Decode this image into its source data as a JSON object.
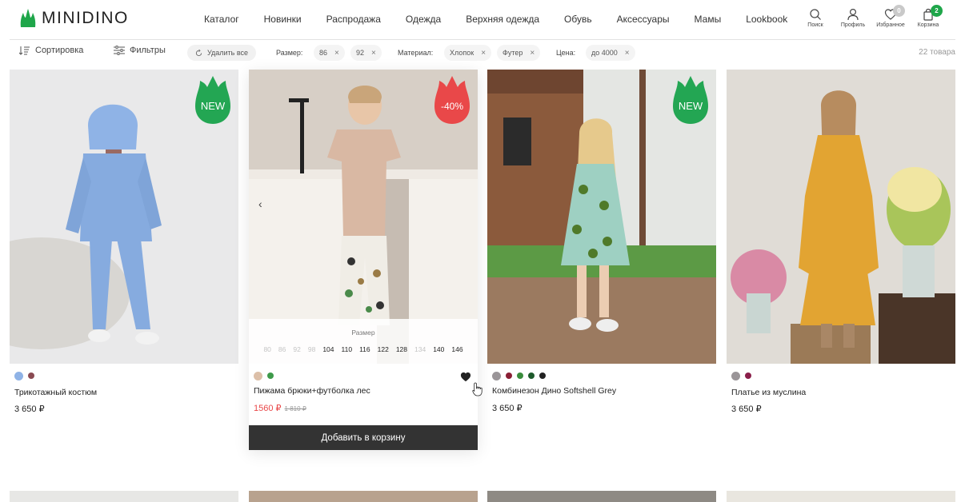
{
  "brand": {
    "name": "MINIDINO"
  },
  "nav": [
    "Каталог",
    "Новинки",
    "Распродажа",
    "Одежда",
    "Верхняя одежда",
    "Обувь",
    "Аксессуары",
    "Мамы",
    "Lookbook"
  ],
  "actions": {
    "search": "Поиск",
    "profile": "Профиль",
    "favorites": "Избранное",
    "favorites_count": "0",
    "cart": "Корзина",
    "cart_count": "2"
  },
  "filters": {
    "sort": "Сортировка",
    "filter": "Фильтры",
    "clear_all": "Удалить все",
    "size_label": "Размер:",
    "size_chips": [
      "86",
      "92"
    ],
    "material_label": "Материал:",
    "material_chips": [
      "Хлопок",
      "Футер"
    ],
    "price_label": "Цена:",
    "price_chip": "до 4000",
    "result_count": "22 товара"
  },
  "products": [
    {
      "name": "Трикотажный костюм",
      "price": "3 650 ₽",
      "badge": "NEW",
      "colors": [
        "#8fb3e6",
        "#8a4a52"
      ]
    },
    {
      "name": "Пижама брюки+футболка лес",
      "price": "1560 ₽",
      "old_price": "1 810 ₽",
      "badge": "-40%",
      "colors": [
        "#dcbfa8",
        "#3e9a4a"
      ],
      "size_title": "Размер",
      "sizes": [
        {
          "label": "80",
          "available": false
        },
        {
          "label": "86",
          "available": false
        },
        {
          "label": "92",
          "available": false
        },
        {
          "label": "98",
          "available": false
        },
        {
          "label": "104",
          "available": true
        },
        {
          "label": "110",
          "available": true
        },
        {
          "label": "116",
          "available": true
        },
        {
          "label": "122",
          "available": true
        },
        {
          "label": "128",
          "available": true
        },
        {
          "label": "134",
          "available": false
        },
        {
          "label": "140",
          "available": true
        },
        {
          "label": "146",
          "available": true
        }
      ],
      "add_to_cart": "Добавить в корзину"
    },
    {
      "name": "Комбинезон Дино Softshell Grey",
      "price": "3 650 ₽",
      "badge": "NEW",
      "colors": [
        "#9a9598",
        "#8a1f35",
        "#3a8c3c",
        "#1d5a2b",
        "#222222"
      ]
    },
    {
      "name": "Платье из муслина",
      "price": "3 650 ₽",
      "colors": [
        "#9a9598",
        "#8a1f4a"
      ]
    }
  ],
  "colors": {
    "accent_green": "#1fa64a",
    "sale_red": "#e94849",
    "button_dark": "#333333",
    "badge_sale": "#e94849"
  }
}
